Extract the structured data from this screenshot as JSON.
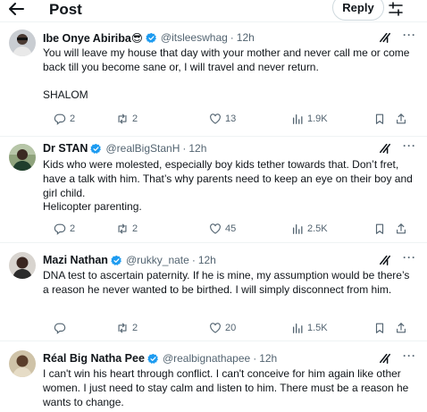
{
  "header": {
    "title": "Post",
    "reply_label": "Reply"
  },
  "posts": [
    {
      "name": "Ibe Onye Abiriba😎",
      "handle": "@itsleeswhag",
      "time": "12h",
      "text": "You will leave my house that day with your mother and never call me or come back till you become sane or, I will travel and never return.\n\nSHALOM",
      "stats": {
        "replies": "2",
        "reposts": "2",
        "likes": "13",
        "views": "1.9K"
      }
    },
    {
      "name": "Dr STAN",
      "handle": "@realBigStanH",
      "time": "12h",
      "text": "Kids who were molested, especially boy kids tether towards that. Don’t fret, have a talk with him. That’s why parents need to keep an eye on their boy and girl child.\nHelicopter parenting.",
      "stats": {
        "replies": "2",
        "reposts": "2",
        "likes": "45",
        "views": "2.5K"
      }
    },
    {
      "name": "Mazi Nathan",
      "handle": "@rukky_nate",
      "time": "12h",
      "text": "DNA test to ascertain paternity. If he is mine, my assumption would be there’s a reason he never wanted to be birthed. I will simply disconnect from him.",
      "stats": {
        "replies": "",
        "reposts": "2",
        "likes": "20",
        "views": "1.5K"
      }
    },
    {
      "name": "Réal Big Natha Pee",
      "handle": "@realbignathapee",
      "time": "12h",
      "text": "I can't win his heart through conflict. I can't conceive for him again like other women. I just need to stay calm and listen to him. There must be a reason he wants to change.",
      "stats": {
        "replies": "",
        "reposts": "",
        "likes": "",
        "views": ""
      }
    }
  ],
  "icons": {
    "back": "arrow-left-icon",
    "filter": "sliders-icon",
    "verified": "verified-badge-icon",
    "grok": "grok-icon",
    "more": "more-icon",
    "reply": "reply-icon",
    "repost": "repost-icon",
    "like": "heart-icon",
    "views": "views-icon",
    "bookmark": "bookmark-icon",
    "share": "share-icon"
  },
  "colors": {
    "verified": "#1d9bf0",
    "muted": "#536471",
    "text": "#0f1419",
    "border": "#eff3f4"
  }
}
